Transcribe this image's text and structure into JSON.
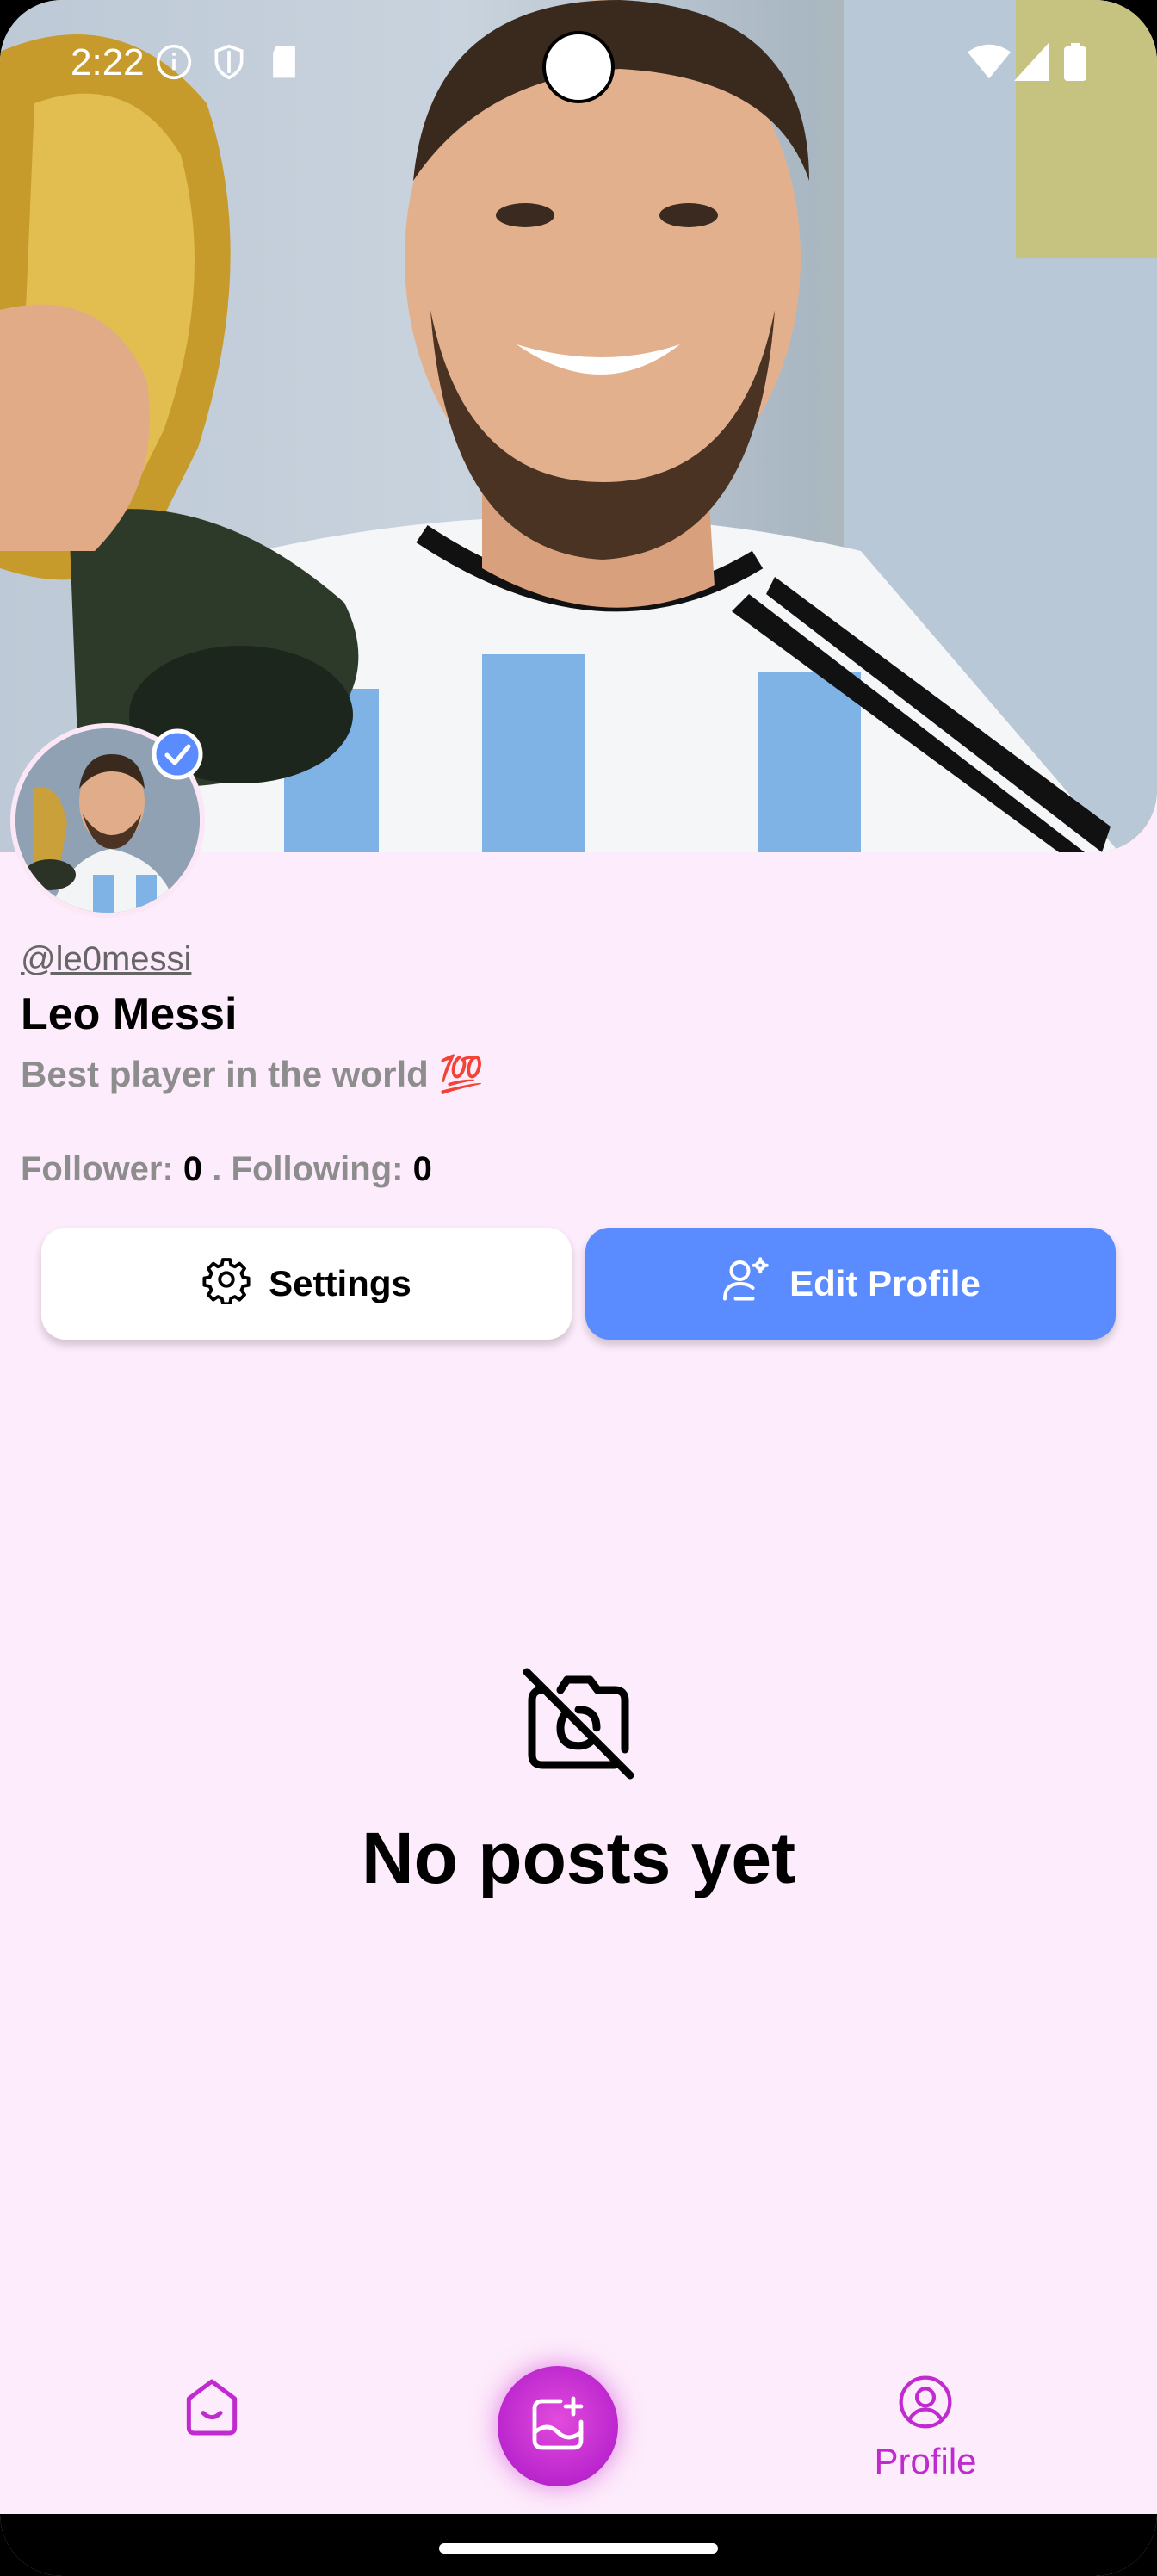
{
  "status_bar": {
    "time": "2:22",
    "icons": [
      "info-icon",
      "shield-icon",
      "sd-card-icon",
      "wifi-icon",
      "signal-icon",
      "battery-icon"
    ]
  },
  "profile": {
    "handle": "@le0messi",
    "name": "Leo Messi",
    "bio": "Best player in the world 💯",
    "verified": true,
    "follower_label": "Follower:",
    "follower_count": "0",
    "separator": ".",
    "following_label": "Following:",
    "following_count": "0"
  },
  "buttons": {
    "settings_label": "Settings",
    "edit_profile_label": "Edit Profile"
  },
  "empty_state": {
    "icon": "no-camera-icon",
    "message": "No posts yet"
  },
  "bottom_nav": {
    "home_icon": "home-icon",
    "add_post_icon": "add-photo-icon",
    "profile_icon": "profile-icon",
    "profile_label": "Profile"
  },
  "colors": {
    "background": "#fdecfb",
    "accent": "#c02bd0",
    "edit_button": "#5b8cff",
    "verified_badge": "#5b8cff",
    "muted_text": "#8d8d8d"
  }
}
